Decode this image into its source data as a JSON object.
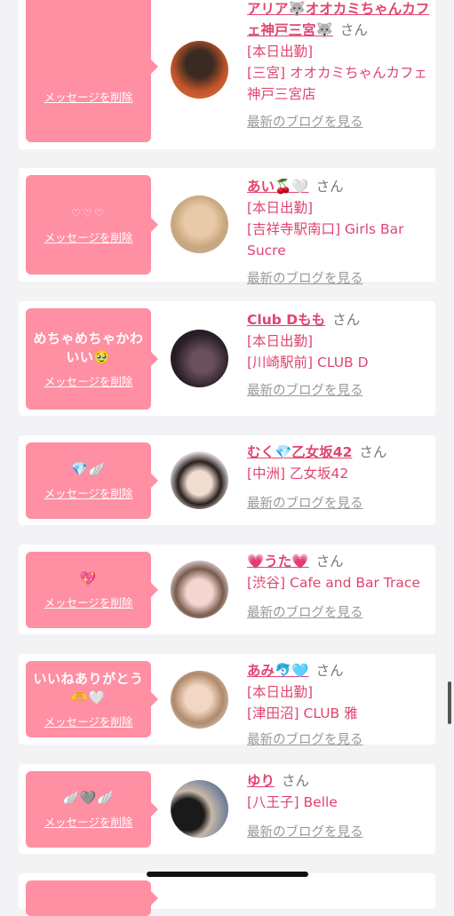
{
  "items": [
    {
      "message": "",
      "delete_label": "メッセージを削除",
      "name": "アリア🐺オオカミちゃんカフェ神戸三宮🐺",
      "honorific": "さん",
      "details": "[本日出勤]\n[三宮] オオカミちゃんカフェ神戸三宮店",
      "blog_label": "最新のブログを見る"
    },
    {
      "message": "♡♡♡",
      "delete_label": "メッセージを削除",
      "name": "あい🍒🤍",
      "honorific": "さん",
      "details": "[本日出勤]\n[吉祥寺駅南口] Girls Bar Sucre",
      "blog_label": "最新のブログを見る"
    },
    {
      "message": "めちゃめちゃかわいい🥹",
      "delete_label": "メッセージを削除",
      "name": "Club Dもも",
      "honorific": "さん",
      "details": "[本日出勤]\n[川崎駅前] CLUB D",
      "blog_label": "最新のブログを見る"
    },
    {
      "message": "💎🪽",
      "delete_label": "メッセージを削除",
      "name": "むく💎乙女坂42",
      "honorific": "さん",
      "details": "[中洲] 乙女坂42",
      "blog_label": "最新のブログを見る"
    },
    {
      "message": "💖",
      "delete_label": "メッセージを削除",
      "name": "💗うた💗",
      "honorific": "さん",
      "details": "[渋谷] Cafe and Bar Trace",
      "blog_label": "最新のブログを見る"
    },
    {
      "message": "いいねありがとう🫶🤍",
      "delete_label": "メッセージを削除",
      "name": "あみ🐬🩵",
      "honorific": "さん",
      "details": "[本日出勤]\n[津田沼] CLUB 雅",
      "blog_label": "最新のブログを見る"
    },
    {
      "message": "🪽🩶🪽",
      "delete_label": "メッセージを削除",
      "name": "ゆり",
      "honorific": "さん",
      "details": "[八王子] Belle",
      "blog_label": "最新のブログを見る"
    },
    {
      "message": "",
      "delete_label": "",
      "name": "",
      "honorific": "",
      "details": "",
      "blog_label": ""
    }
  ],
  "colors": {
    "accent": "#e0456f",
    "bubble": "#ff8fa3",
    "background": "#f3f3f5"
  }
}
